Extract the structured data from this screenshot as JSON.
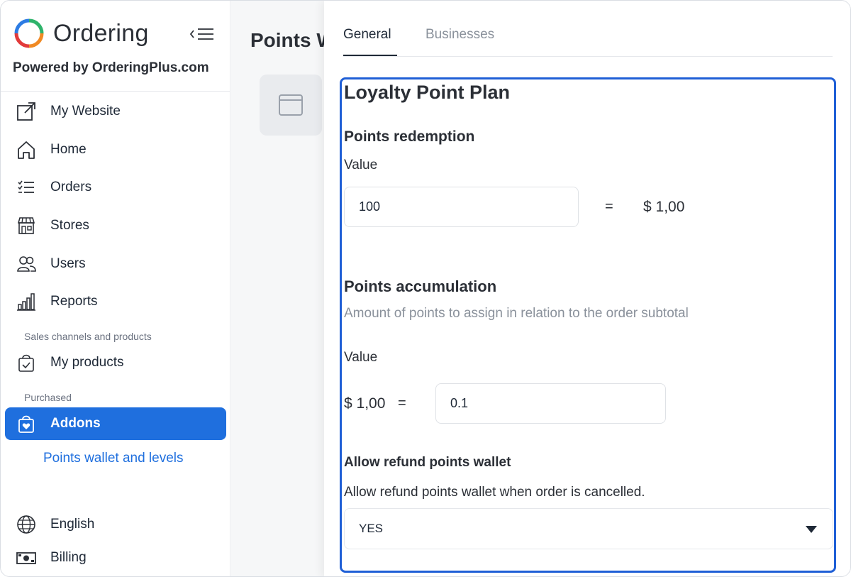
{
  "sidebar": {
    "brand_name": "Ordering",
    "powered_by": "Powered by OrderingPlus.com",
    "items": [
      {
        "label": "My Website",
        "icon": "external-link-icon"
      },
      {
        "label": "Home",
        "icon": "home-icon"
      },
      {
        "label": "Orders",
        "icon": "list-check-icon"
      },
      {
        "label": "Stores",
        "icon": "store-icon"
      },
      {
        "label": "Users",
        "icon": "users-icon"
      },
      {
        "label": "Reports",
        "icon": "bar-chart-icon"
      },
      {
        "label": "My products",
        "icon": "shopping-bag-check-icon"
      },
      {
        "label": "Addons",
        "icon": "bag-heart-icon"
      },
      {
        "label": "English",
        "icon": "globe-icon"
      },
      {
        "label": "Billing",
        "icon": "cash-icon"
      }
    ],
    "section_sales": "Sales channels and products",
    "section_purchased": "Purchased",
    "sub_item": "Points wallet and levels",
    "active_item": "Addons",
    "accent_color": "#1f6fde"
  },
  "main": {
    "title": "Points Wallet"
  },
  "panel": {
    "tabs": [
      {
        "label": "General",
        "active": true
      },
      {
        "label": "Businesses",
        "active": false
      }
    ],
    "plan_title": "Loyalty Point Plan",
    "redemption": {
      "heading": "Points redemption",
      "value_label": "Value",
      "value": "100",
      "equals": "=",
      "money": "$ 1,00"
    },
    "accumulation": {
      "heading": "Points accumulation",
      "description": "Amount of points to assign in relation to the order subtotal",
      "value_label": "Value",
      "money": "$ 1,00",
      "equals": "=",
      "value": "0.1"
    },
    "refund": {
      "heading": "Allow refund points wallet",
      "description": "Allow refund points wallet when order is cancelled.",
      "selected": "YES"
    },
    "highlight_color": "#1f5fd6"
  }
}
